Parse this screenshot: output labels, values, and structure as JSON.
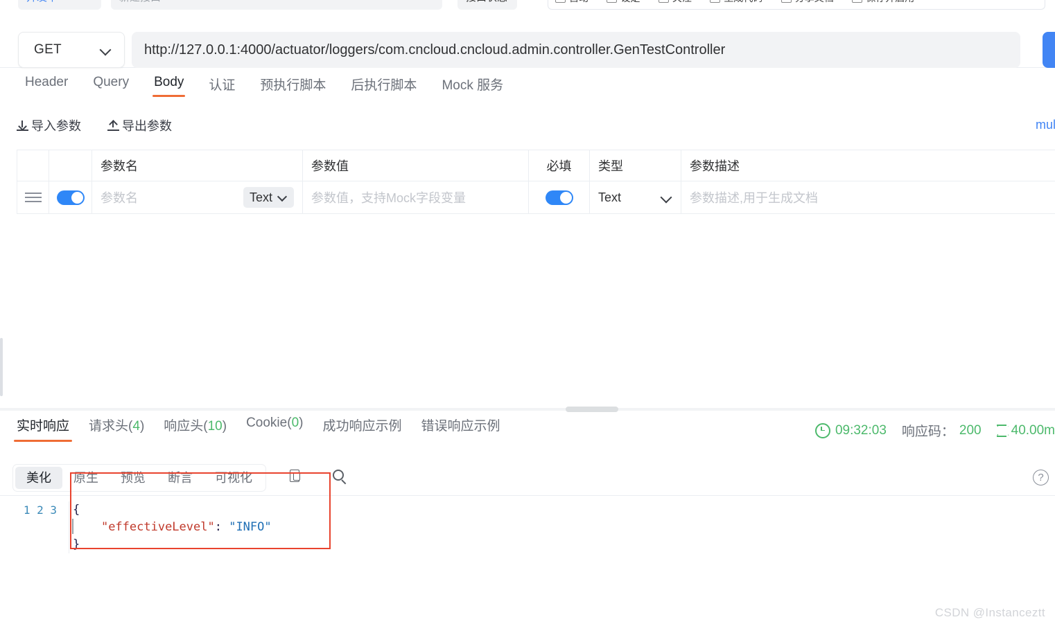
{
  "top_strip": {
    "workspace_label": "开发中",
    "api_name_placeholder": "新建接口",
    "api_status_label": "接口状态",
    "checkboxes": [
      {
        "label": "自动",
        "checked": false
      },
      {
        "label": "设定",
        "checked": false
      },
      {
        "label": "关注",
        "checked": false
      },
      {
        "label": "生成代码",
        "checked": false
      },
      {
        "label": "分享文档",
        "checked": false
      },
      {
        "label": "保存并启用",
        "checked": false
      }
    ]
  },
  "url_bar": {
    "method": "GET",
    "url": "http://127.0.0.1:4000/actuator/loggers/com.cncloud.cncloud.admin.controller.GenTestController",
    "send_label": ""
  },
  "request_tabs": [
    {
      "label": "Header",
      "active": false
    },
    {
      "label": "Query",
      "active": false
    },
    {
      "label": "Body",
      "active": true
    },
    {
      "label": "认证",
      "active": false
    },
    {
      "label": "预执行脚本",
      "active": false
    },
    {
      "label": "后执行脚本",
      "active": false
    },
    {
      "label": "Mock 服务",
      "active": false
    }
  ],
  "param_actions": {
    "import_label": "导入参数",
    "export_label": "导出参数",
    "body_type_link": "mult"
  },
  "param_table": {
    "headers": {
      "handle": "",
      "enabled": "",
      "name": "参数名",
      "value": "参数值",
      "required": "必填",
      "type": "类型",
      "description": "参数描述"
    },
    "rows": [
      {
        "enabled": true,
        "name_value": "",
        "name_placeholder": "参数名",
        "name_type": "Text",
        "value_value": "",
        "value_placeholder": "参数值，支持Mock字段变量",
        "required": true,
        "type": "Text",
        "description_value": "",
        "description_placeholder": "参数描述,用于生成文档"
      }
    ]
  },
  "response_tabs": [
    {
      "label": "实时响应",
      "count": null,
      "active": true
    },
    {
      "label": "请求头",
      "count": "4",
      "active": false
    },
    {
      "label": "响应头",
      "count": "10",
      "active": false
    },
    {
      "label": "Cookie",
      "count": "0",
      "active": false
    },
    {
      "label": "成功响应示例",
      "count": null,
      "active": false
    },
    {
      "label": "错误响应示例",
      "count": null,
      "active": false
    }
  ],
  "response_meta": {
    "time": "09:32:03",
    "status_label": "响应码：",
    "status_code": "200",
    "duration": "40.00m"
  },
  "editor_toolbar": {
    "views": [
      {
        "label": "美化",
        "active": true
      },
      {
        "label": "原生",
        "active": false
      },
      {
        "label": "预览",
        "active": false
      },
      {
        "label": "断言",
        "active": false
      },
      {
        "label": "可视化",
        "active": false
      }
    ],
    "copy_icon": "copy-icon",
    "search_icon": "search-icon",
    "help_icon": "help-icon"
  },
  "code": {
    "line_numbers": "1\n2\n3",
    "line1": "{",
    "line2_indent": "    ",
    "line2_key": "\"effectiveLevel\"",
    "line2_colon": ": ",
    "line2_value": "\"INFO\"",
    "line3": "}"
  },
  "watermark": "CSDN @Instanceztt",
  "colors": {
    "accent_orange": "#ef6c35",
    "brand_blue": "#4285f4",
    "success_green": "#4cb96b",
    "annotation_red": "#e8432e"
  }
}
